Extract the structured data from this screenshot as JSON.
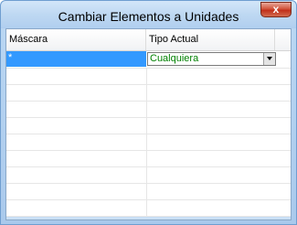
{
  "window": {
    "title": "Cambiar Elementos a Unidades",
    "close_label": "x"
  },
  "grid": {
    "columns": [
      "Máscara",
      "Tipo Actual"
    ],
    "rows": [
      {
        "mask": "*",
        "type": "Cualquiera"
      }
    ],
    "empty_rows": 10
  },
  "colors": {
    "selection": "#3399ff",
    "type_text": "#008000",
    "close_button": "#c1301b"
  }
}
